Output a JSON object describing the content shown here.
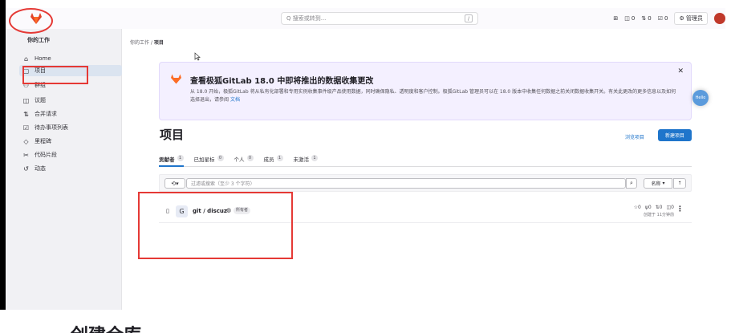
{
  "colors": {
    "accent": "#1f75cb",
    "annotation_red": "#e53935",
    "brand": "#e24329"
  },
  "header": {
    "search_placeholder": "Q 搜索或转到...",
    "search_shortcut": "/",
    "counts": {
      "issues": "0",
      "merge_requests": "0",
      "todos": "0"
    },
    "admin_label": "管理员"
  },
  "sidebar": {
    "title": "你的工作",
    "items": [
      {
        "icon": "home-icon",
        "glyph": "⌂",
        "label": "Home"
      },
      {
        "icon": "project-icon",
        "glyph": "▢",
        "label": "项目"
      },
      {
        "icon": "group-icon",
        "glyph": "⚇",
        "label": "群组"
      },
      {
        "icon": "issues-icon",
        "glyph": "◫",
        "label": "议题"
      },
      {
        "icon": "merge-request-icon",
        "glyph": "⇅",
        "label": "合并请求"
      },
      {
        "icon": "todo-icon",
        "glyph": "☑",
        "label": "待办事项列表"
      },
      {
        "icon": "milestone-icon",
        "glyph": "◇",
        "label": "里程碑"
      },
      {
        "icon": "snippet-icon",
        "glyph": "✂",
        "label": "代码片段"
      },
      {
        "icon": "activity-icon",
        "glyph": "↺",
        "label": "动态"
      }
    ]
  },
  "breadcrumb": {
    "parent": "你的工作",
    "current": "项目"
  },
  "banner": {
    "title": "查看极狐GitLab 18.0 中即将推出的数据收集更改",
    "text": "从 18.0 开始，极狐GitLab 将从私有化部署和专用实例收集事件级产品使用数据，同时确保隐私、透明度和客户控制。极狐GitLab 管理员可以在 18.0 版本中收集任何数据之前关闭数据收集开关。有关此更改的更多信息以及如何选择退出，请参阅",
    "link": "文档"
  },
  "floating_bubble": "Hello",
  "main": {
    "title": "项目",
    "explore_label": "浏览项目",
    "new_project_label": "新建项目",
    "tabs": [
      {
        "label": "贡献者",
        "count": "1"
      },
      {
        "label": "已加星标",
        "count": "0"
      },
      {
        "label": "个人",
        "count": "0"
      },
      {
        "label": "成员",
        "count": "1"
      },
      {
        "label": "未激活",
        "count": "1"
      }
    ],
    "filter": {
      "placeholder": "过滤或搜索（至少 3 个字符）",
      "sort_label": "名称",
      "sort_direction": "↑",
      "history_glyph": "⟲"
    },
    "project": {
      "avatar_letter": "G",
      "name": "git / discuz",
      "role": "所有者",
      "stars": "0",
      "forks": "0",
      "merge_requests": "0",
      "issues": "0",
      "updated": "创建于 11分钟前"
    }
  },
  "bottom_heading": "创建仓库"
}
